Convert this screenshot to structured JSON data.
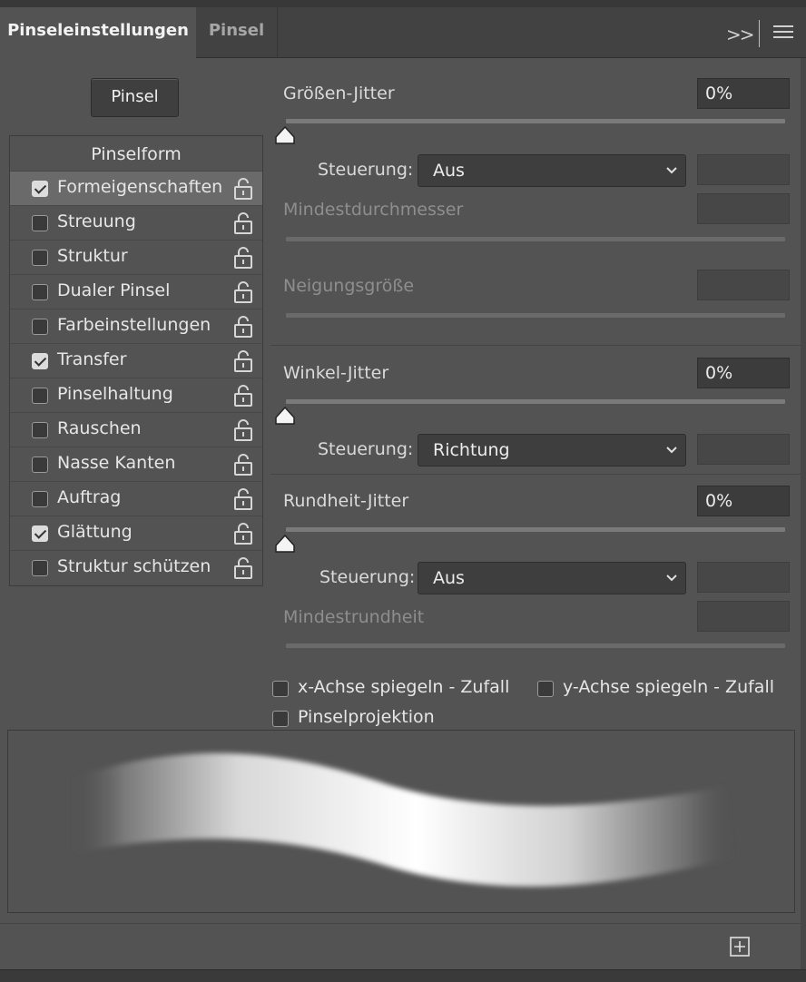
{
  "tabs": [
    {
      "label": "Pinseleinstellungen",
      "active": true
    },
    {
      "label": "Pinsel",
      "active": false
    }
  ],
  "panel_menu": {
    "expand_glyph": ">>"
  },
  "pinsel_button": "Pinsel",
  "left_panel": {
    "header": "Pinselform",
    "items": [
      {
        "label": "Formeigenschaften",
        "checked": true,
        "selected": true
      },
      {
        "label": "Streuung",
        "checked": false
      },
      {
        "label": "Struktur",
        "checked": false
      },
      {
        "label": "Dualer Pinsel",
        "checked": false
      },
      {
        "label": "Farbeinstellungen",
        "checked": false
      },
      {
        "label": "Transfer",
        "checked": true
      },
      {
        "label": "Pinselhaltung",
        "checked": false
      },
      {
        "label": "Rauschen",
        "checked": false
      },
      {
        "label": "Nasse Kanten",
        "checked": false
      },
      {
        "label": "Auftrag",
        "checked": false
      },
      {
        "label": "Glättung",
        "checked": true
      },
      {
        "label": "Struktur schützen",
        "checked": false
      }
    ]
  },
  "size_jitter": {
    "label": "Größen-Jitter",
    "value": "0%",
    "control_label": "Steuerung:",
    "control_value": "Aus",
    "min_label": "Mindestdurchmesser",
    "tilt_label": "Neigungsgröße"
  },
  "angle_jitter": {
    "label": "Winkel-Jitter",
    "value": "0%",
    "control_label": "Steuerung:",
    "control_value": "Richtung"
  },
  "roundness_jitter": {
    "label": "Rundheit-Jitter",
    "value": "0%",
    "control_label": "Steuerung:",
    "control_value": "Aus",
    "min_label": "Mindestrundheit"
  },
  "options": {
    "flip_x": "x-Achse spiegeln - Zufall",
    "flip_y": "y-Achse spiegeln - Zufall",
    "projection": "Pinselprojektion"
  },
  "colors": {
    "panel_bg": "#535353",
    "field_bg": "#3c3c3c"
  }
}
